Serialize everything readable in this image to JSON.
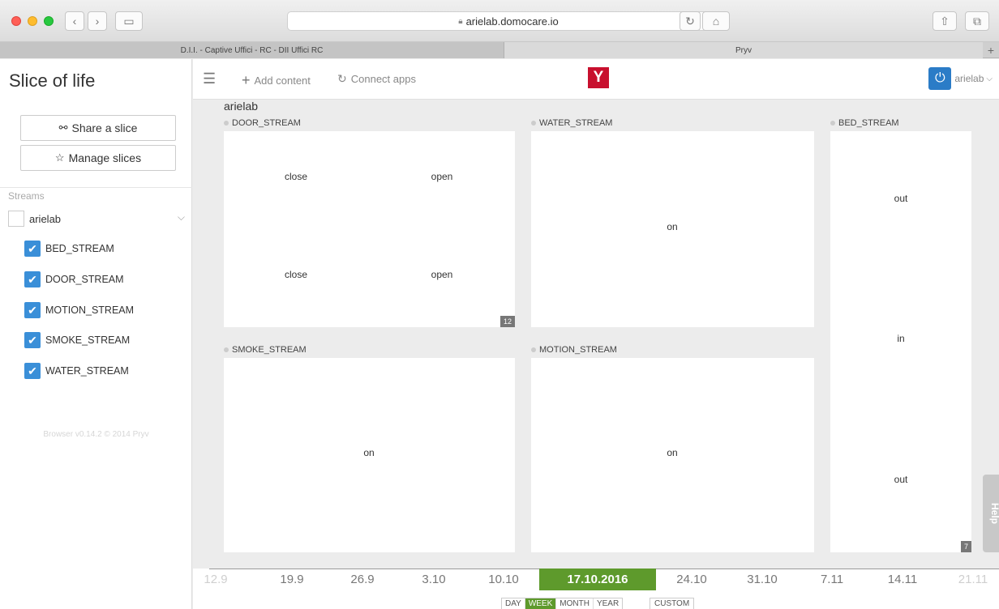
{
  "browser": {
    "url": "arielab.domocare.io",
    "tabs": [
      "D.I.I. - Captive Uffici - RC - DII Uffici RC",
      "Pryv"
    ]
  },
  "sidebar": {
    "title": "Slice of life",
    "share_label": "Share a slice",
    "manage_label": "Manage slices",
    "streams_label": "Streams",
    "root_stream": "arielab",
    "streams": [
      "BED_STREAM",
      "DOOR_STREAM",
      "MOTION_STREAM",
      "SMOKE_STREAM",
      "WATER_STREAM"
    ],
    "version": "Browser v0.14.2 © 2014 Pryv"
  },
  "appbar": {
    "add_content": "Add content",
    "connect_apps": "Connect apps",
    "logo_letter": "Y",
    "username": "arielab"
  },
  "content": {
    "heading": "arielab",
    "panels": {
      "door": {
        "title": "DOOR_STREAM",
        "events": [
          "close",
          "open",
          "close",
          "open"
        ],
        "count": "12"
      },
      "water": {
        "title": "WATER_STREAM",
        "events": [
          "on"
        ]
      },
      "bed": {
        "title": "BED_STREAM",
        "events": [
          "out",
          "in",
          "out"
        ],
        "count": "7"
      },
      "smoke": {
        "title": "SMOKE_STREAM",
        "events": [
          "on"
        ]
      },
      "motion": {
        "title": "MOTION_STREAM",
        "events": [
          "on"
        ]
      }
    },
    "help_label": "Help"
  },
  "timeline": {
    "ticks": [
      "12.9",
      "19.9",
      "26.9",
      "3.10",
      "10.10",
      "24.10",
      "31.10",
      "7.11",
      "14.11",
      "21.11"
    ],
    "current": "17.10.2016",
    "ranges": [
      "DAY",
      "WEEK",
      "MONTH",
      "YEAR"
    ],
    "active_range": "WEEK",
    "custom_label": "CUSTOM"
  },
  "colors": {
    "accent_green": "#5e9a2c",
    "check_blue": "#3a8fd8",
    "logo_red": "#c8102e"
  }
}
